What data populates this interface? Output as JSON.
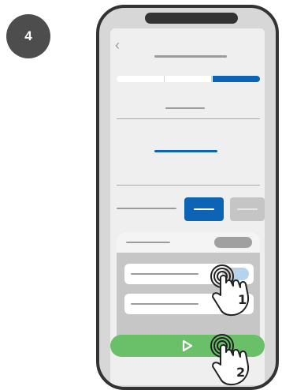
{
  "step": {
    "number": "4"
  },
  "progress": {
    "value": 0.33
  },
  "switch": {
    "state": "on"
  },
  "gestures": {
    "tap1": {
      "label": "1"
    },
    "tap2": {
      "label": "2"
    }
  },
  "icons": {
    "back": "chevron-left-icon",
    "play": "play-icon",
    "hand": "hand-pointer-icon"
  },
  "colors": {
    "accent": "#0d64b5",
    "play_button": "#6abf69",
    "badge": "#4d4d4d"
  }
}
